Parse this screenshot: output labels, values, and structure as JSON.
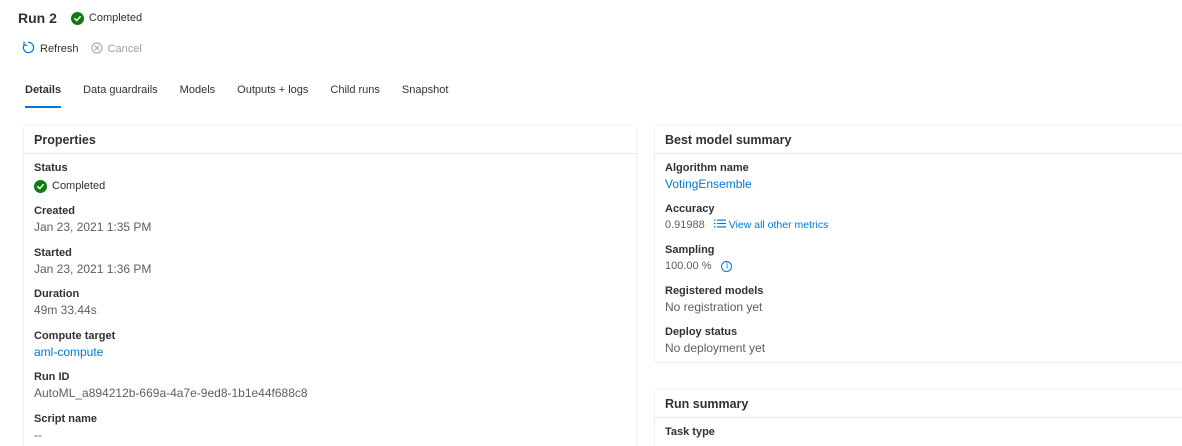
{
  "header": {
    "title": "Run 2",
    "status": "Completed"
  },
  "toolbar": {
    "refresh_label": "Refresh",
    "cancel_label": "Cancel"
  },
  "tabs": [
    {
      "label": "Details"
    },
    {
      "label": "Data guardrails"
    },
    {
      "label": "Models"
    },
    {
      "label": "Outputs + logs"
    },
    {
      "label": "Child runs"
    },
    {
      "label": "Snapshot"
    }
  ],
  "properties": {
    "title": "Properties",
    "status_label": "Status",
    "status_value": "Completed",
    "created_label": "Created",
    "created_value": "Jan 23, 2021 1:35 PM",
    "started_label": "Started",
    "started_value": "Jan 23, 2021 1:36 PM",
    "duration_label": "Duration",
    "duration_value": "49m 33.44s",
    "compute_label": "Compute target",
    "compute_value": "aml-compute",
    "runid_label": "Run ID",
    "runid_value": "AutoML_a894212b-669a-4a7e-9ed8-1b1e44f688c8",
    "script_label": "Script name",
    "script_value": "--"
  },
  "best_model": {
    "title": "Best model summary",
    "algorithm_label": "Algorithm name",
    "algorithm_value": "VotingEnsemble",
    "accuracy_label": "Accuracy",
    "accuracy_value": "0.91988",
    "metrics_link": "View all other metrics",
    "sampling_label": "Sampling",
    "sampling_value": "100.00 %",
    "registered_label": "Registered models",
    "registered_value": "No registration yet",
    "deploy_label": "Deploy status",
    "deploy_value": "No deployment yet"
  },
  "run_summary": {
    "title": "Run summary",
    "task_label": "Task type"
  },
  "colors": {
    "accent": "#0078d4",
    "success": "#107c10"
  }
}
